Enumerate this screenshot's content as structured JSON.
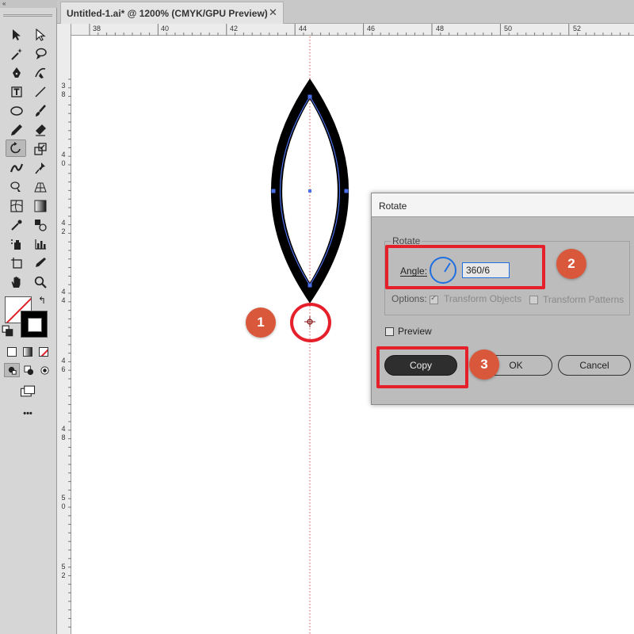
{
  "window": {
    "document_tab": "Untitled-1.ai* @ 1200% (CMYK/GPU Preview)",
    "tab_close": "✕"
  },
  "rulers": {
    "horizontal": [
      "38",
      "40",
      "42",
      "44",
      "46",
      "48",
      "50",
      "52"
    ],
    "vertical": [
      [
        "3",
        "8"
      ],
      [
        "4",
        "0"
      ],
      [
        "4",
        "2"
      ],
      [
        "4",
        "4"
      ],
      [
        "4",
        "6"
      ],
      [
        "4",
        "8"
      ],
      [
        "5",
        "0"
      ],
      [
        "5",
        "2"
      ]
    ]
  },
  "toolbar": {
    "more_label": "•••",
    "tools": [
      "selection-tool",
      "direct-selection-tool",
      "magic-wand-tool",
      "lasso-tool",
      "pen-tool",
      "curvature-tool",
      "type-tool",
      "line-segment-tool",
      "ellipse-tool",
      "paintbrush-tool",
      "pencil-tool",
      "eraser-tool",
      "rotate-tool",
      "scale-tool",
      "width-tool",
      "puppet-warp-tool",
      "shape-builder-tool",
      "perspective-grid-tool",
      "mesh-tool",
      "gradient-tool",
      "eyedropper-tool",
      "blend-tool",
      "symbol-sprayer-tool",
      "column-graph-tool",
      "artboard-tool",
      "slice-tool",
      "hand-tool",
      "zoom-tool"
    ],
    "active_tool": "rotate-tool"
  },
  "dialog": {
    "title": "Rotate",
    "group_label": "Rotate",
    "angle_label": "Angle:",
    "angle_value": "360/6",
    "options_label": "Options:",
    "transform_objects_label": "Transform Objects",
    "transform_patterns_label": "Transform Patterns",
    "preview_label": "Preview",
    "copy_label": "Copy",
    "ok_label": "OK",
    "cancel_label": "Cancel",
    "transform_objects_checked": true,
    "transform_patterns_checked": false,
    "preview_checked": false
  },
  "annotations": {
    "step1": "1",
    "step2": "2",
    "step3": "3",
    "highlight_color": "#e5202b",
    "callout_color": "#d9583b"
  },
  "colors": {
    "selection_blue": "#4a6fe8",
    "guide_red": "#d9534f",
    "dial_blue": "#1f6fe0"
  }
}
